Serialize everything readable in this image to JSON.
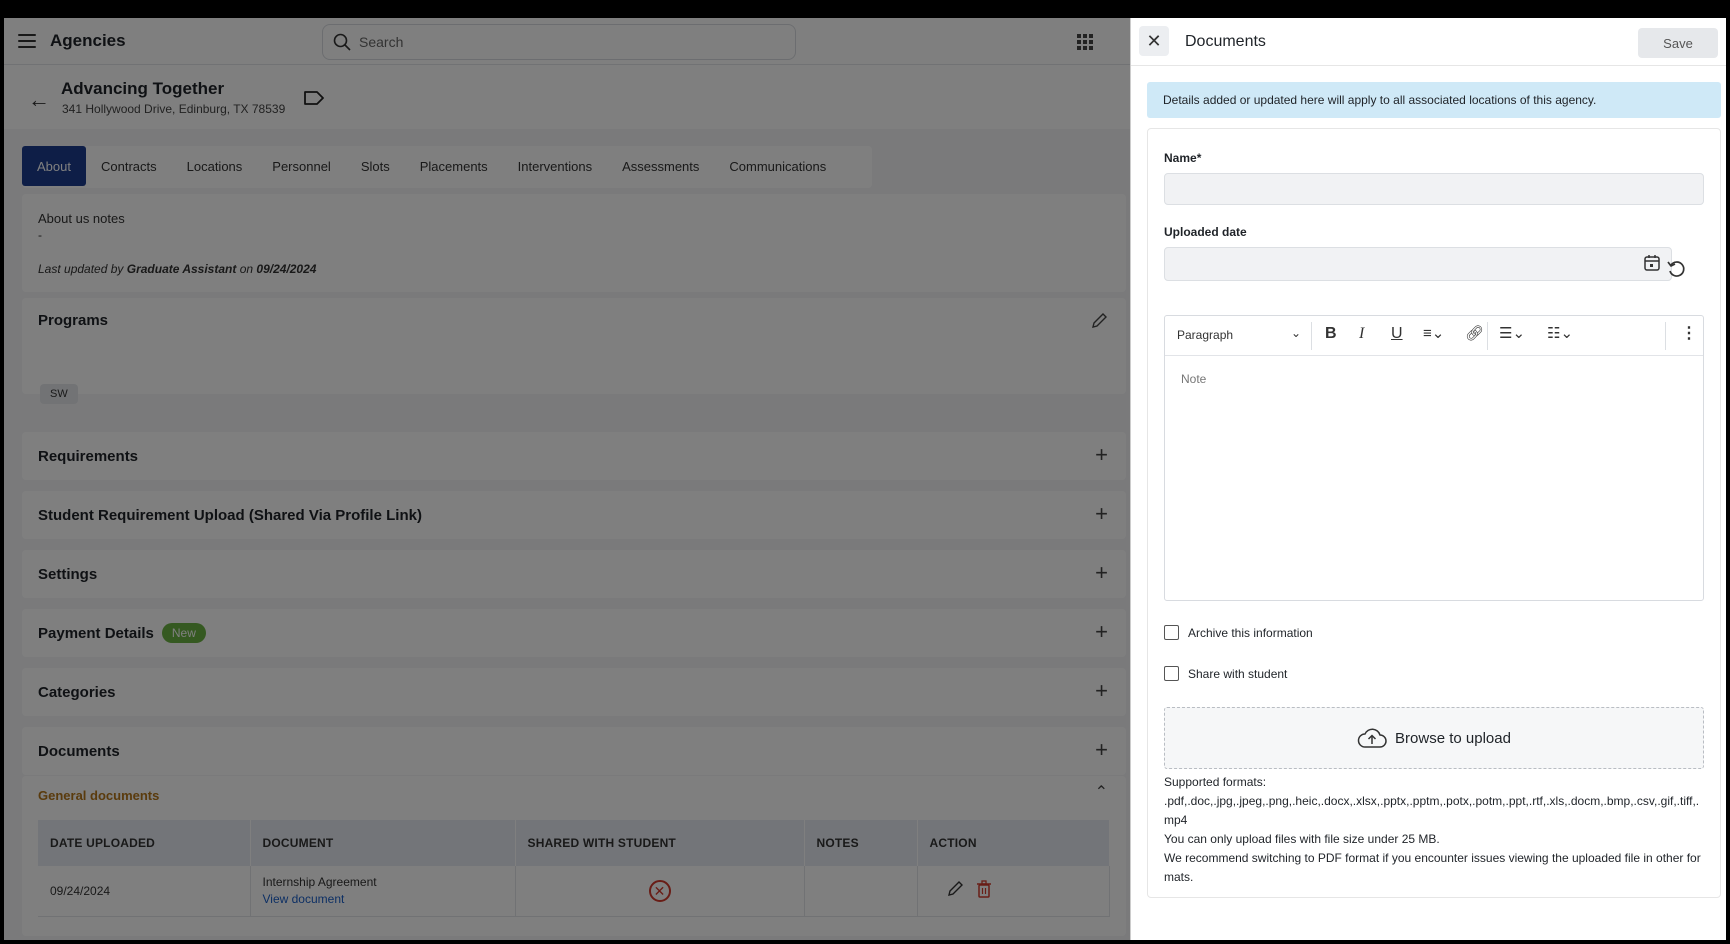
{
  "header": {
    "app_title": "Agencies",
    "search_placeholder": "Search"
  },
  "agency": {
    "name": "Advancing Together",
    "address": "341 Hollywood Drive, Edinburg, TX 78539"
  },
  "tabs": [
    {
      "label": "About",
      "active": true
    },
    {
      "label": "Contracts"
    },
    {
      "label": "Locations"
    },
    {
      "label": "Personnel"
    },
    {
      "label": "Slots"
    },
    {
      "label": "Placements"
    },
    {
      "label": "Interventions"
    },
    {
      "label": "Assessments"
    },
    {
      "label": "Communications"
    }
  ],
  "about": {
    "notes_label": "About us notes",
    "notes_value": "-",
    "updated_prefix": "Last updated by",
    "updated_by": "Graduate Assistant",
    "updated_on_word": "on",
    "updated_date": "09/24/2024"
  },
  "sections": {
    "programs": "Programs",
    "program_chip": "SW",
    "requirements": "Requirements",
    "student_upload": "Student Requirement Upload (Shared Via Profile Link)",
    "settings": "Settings",
    "payment": "Payment Details",
    "payment_badge": "New",
    "categories": "Categories",
    "documents": "Documents"
  },
  "documents_table": {
    "group_label": "General documents",
    "columns": [
      "DATE UPLOADED",
      "DOCUMENT",
      "SHARED WITH STUDENT",
      "NOTES",
      "ACTION"
    ],
    "rows": [
      {
        "date": "09/24/2024",
        "document": "Internship Agreement",
        "link": "View document",
        "shared": false,
        "notes": ""
      }
    ]
  },
  "drawer": {
    "title": "Documents",
    "save_label": "Save",
    "info": "Details added or updated here will apply to all associated locations of this agency.",
    "name_label": "Name",
    "required_mark": "*",
    "uploaded_date_label": "Uploaded date",
    "editor": {
      "block_style": "Paragraph",
      "placeholder": "Note"
    },
    "archive_label": "Archive this information",
    "share_label": "Share with student",
    "upload_label": "Browse to upload",
    "formats_title": "Supported formats:",
    "formats_list": ".pdf,.doc,.jpg,.jpeg,.png,.heic,.docx,.xlsx,.pptx,.pptm,.potx,.potm,.ppt,.rtf,.xls,.docm,.bmp,.csv,.gif,.tiff,.mp4",
    "size_note": "You can only upload files with file size under 25 MB.",
    "pdf_note": "We recommend switching to PDF format if you encounter issues viewing the uploaded file in other formats."
  },
  "colors": {
    "primary": "#1d3d8f",
    "badge_green": "#6bb342",
    "info_bg": "#cfe9f7",
    "danger": "#d33a2c",
    "link": "#1a5fc8",
    "warn_label": "#b5761a"
  }
}
